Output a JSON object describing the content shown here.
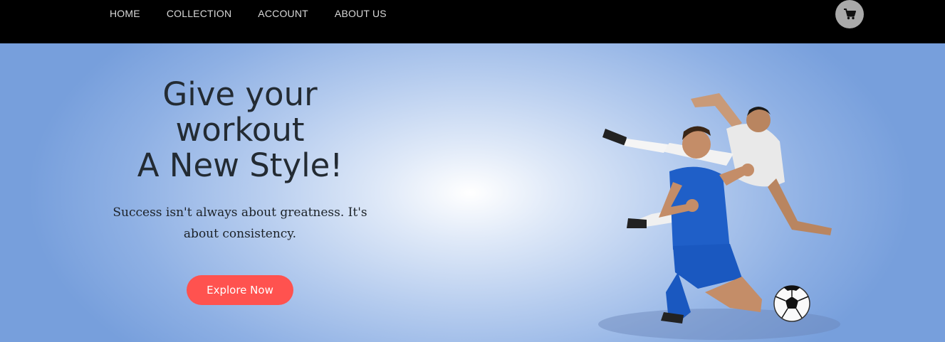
{
  "nav": {
    "items": [
      "HOME",
      "COLLECTION",
      "ACCOUNT",
      "ABOUT US"
    ]
  },
  "header": {
    "cart_icon": "shopping-cart-icon"
  },
  "hero": {
    "headline_lines": [
      "Give your",
      "workout",
      "A New Style!"
    ],
    "subtitle": "Success isn't always about greatness. It's about consistency.",
    "cta_label": "Explore Now",
    "image": "football-players-illustration"
  },
  "colors": {
    "topbar": "#000000",
    "cta": "#ff524f",
    "cart_bg": "#a9a9a9",
    "hero_edge": "#779fdc"
  }
}
